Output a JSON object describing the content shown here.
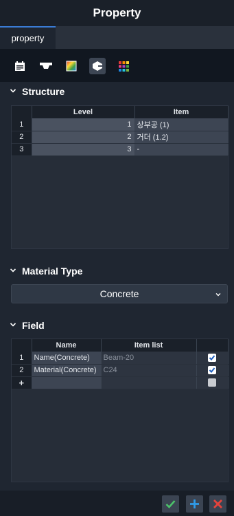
{
  "window": {
    "title": "Property"
  },
  "tabs": [
    {
      "label": "property"
    }
  ],
  "toolbar": {
    "icons": [
      "calendar-icon",
      "beam-section-icon",
      "color-gradient-icon",
      "shape-c-icon",
      "palette-grid-icon"
    ],
    "active_index": 3
  },
  "structure": {
    "heading": "Structure",
    "columns": [
      "Level",
      "Item"
    ],
    "rows": [
      {
        "row": "1",
        "level": "1",
        "item": "상부공 (1)"
      },
      {
        "row": "2",
        "level": "2",
        "item": "거더 (1.2)"
      },
      {
        "row": "3",
        "level": "3",
        "item": "-"
      }
    ]
  },
  "material_type": {
    "heading": "Material Type",
    "selected": "Concrete"
  },
  "field": {
    "heading": "Field",
    "columns": [
      "Name",
      "Item list",
      ""
    ],
    "rows": [
      {
        "row": "1",
        "name": "Name(Concrete)",
        "item_list": "Beam-20",
        "checked": true
      },
      {
        "row": "2",
        "name": "Material(Concrete)",
        "item_list": "C24",
        "checked": true
      }
    ],
    "new_row_marker": "+"
  },
  "actions": {
    "confirm": "check-icon",
    "add": "plus-icon",
    "cancel": "close-icon"
  },
  "colors": {
    "accent_green": "#4cc36a",
    "accent_blue": "#2f9be8",
    "accent_red": "#e5433c"
  }
}
